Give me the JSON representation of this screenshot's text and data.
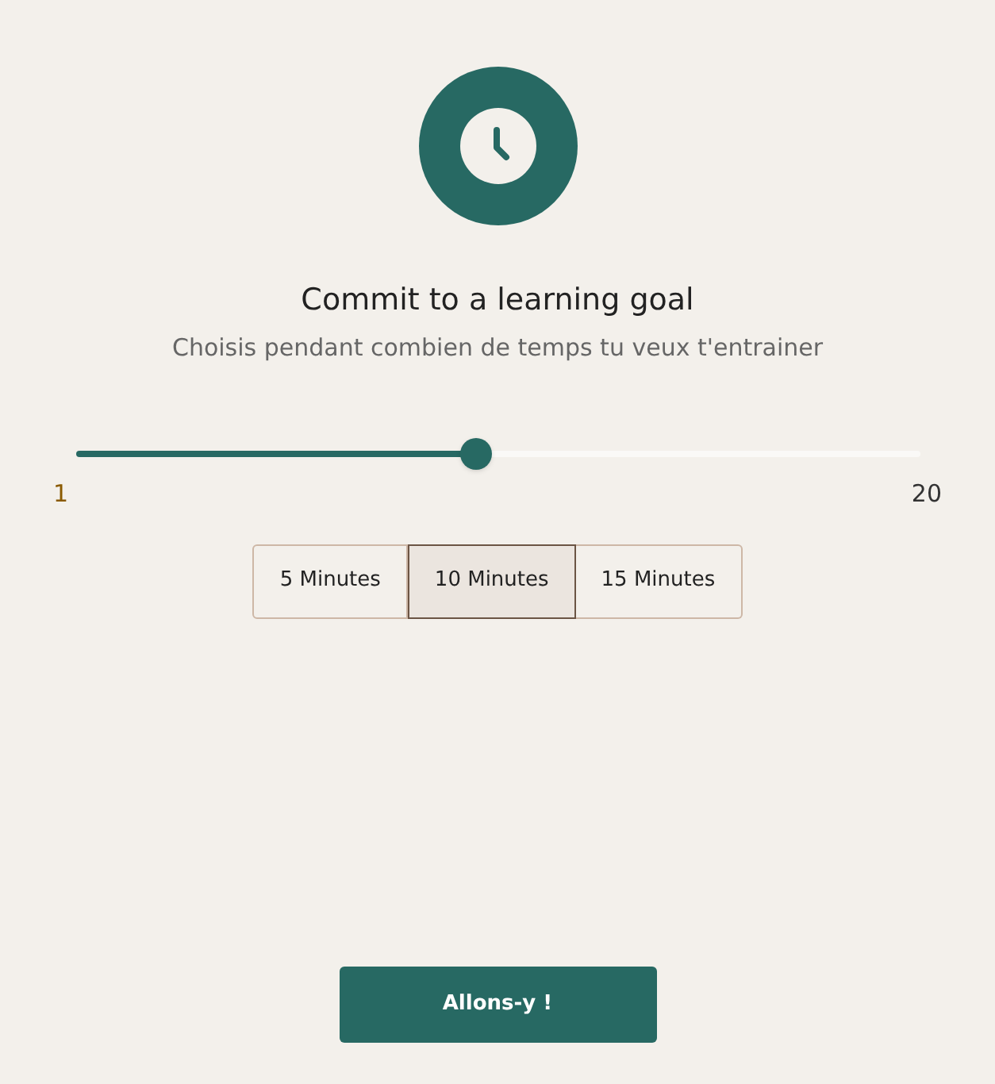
{
  "title": "Commit to a learning goal",
  "subtitle": "Choisis pendant combien de temps tu veux t'entrainer",
  "slider": {
    "level": 0.474,
    "min_label": "1",
    "max_label": "20"
  },
  "options": [
    {
      "label": "5 Minutes",
      "selected": false
    },
    {
      "label": "10 Minutes",
      "selected": true
    },
    {
      "label": "15 Minutes",
      "selected": false
    }
  ],
  "submit": "Allons-y !"
}
